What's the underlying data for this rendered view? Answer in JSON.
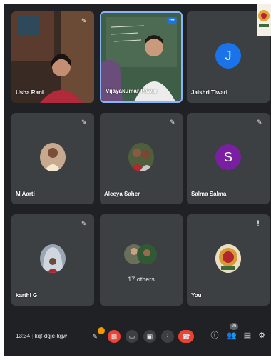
{
  "participants": [
    {
      "name": "Usha Rani"
    },
    {
      "name": "Vijayakumar Pawar"
    },
    {
      "name": "Jaishri Tiwari",
      "initial": "J",
      "avatar_color": "#1a73e8"
    },
    {
      "name": "M Aarti"
    },
    {
      "name": "Aleeya Saher"
    },
    {
      "name": "Salma Salma",
      "initial": "S",
      "avatar_color": "#7b1fa2"
    },
    {
      "name": "karthi G"
    },
    {
      "others": "17 others"
    },
    {
      "name": "You"
    }
  ],
  "bottom_bar": {
    "time": "13:34",
    "meeting_code": "kqf-dgje-kgw",
    "participant_count": "26"
  },
  "icons": {
    "mic_off": "mic-off-icon",
    "more": "more-options-icon",
    "info": "info-icon",
    "people": "people-icon",
    "chat": "chat-icon",
    "activities": "activities-icon",
    "camera_off": "camera-off-icon",
    "captions": "captions-icon",
    "present": "present-icon",
    "leave": "leave-call-icon"
  },
  "colors": {
    "background": "#202124",
    "tile": "#3c4043",
    "active_border": "#8ab4f8",
    "danger": "#ea4335"
  }
}
